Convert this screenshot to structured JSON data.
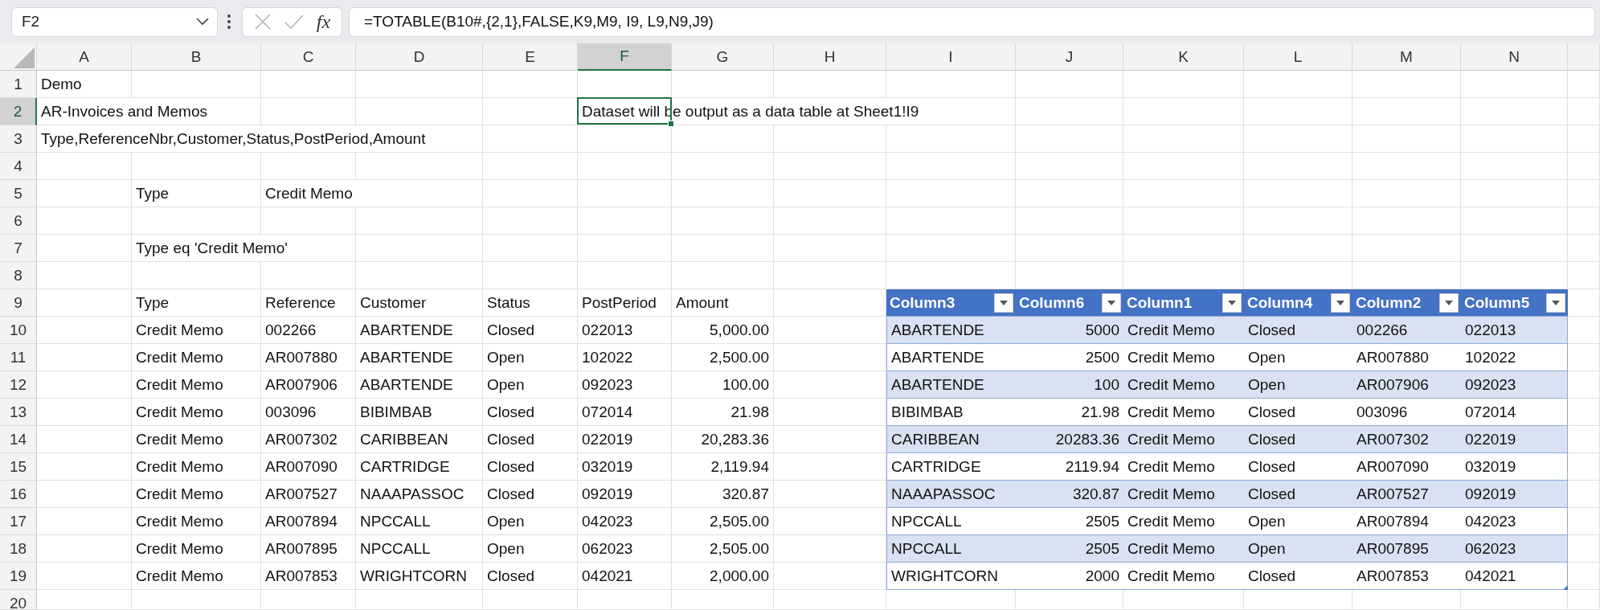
{
  "formula_bar": {
    "name_box": "F2",
    "fx_label": "fx",
    "formula": "=TOTABLE(B10#,{2,1},FALSE,K9,M9, I9, L9,N9,J9)"
  },
  "sheet": {
    "columns": [
      {
        "label": "A",
        "selected": false
      },
      {
        "label": "B",
        "selected": false
      },
      {
        "label": "C",
        "selected": false
      },
      {
        "label": "D",
        "selected": false
      },
      {
        "label": "E",
        "selected": false
      },
      {
        "label": "F",
        "selected": true
      },
      {
        "label": "G",
        "selected": false
      },
      {
        "label": "H",
        "selected": false
      },
      {
        "label": "I",
        "selected": false
      },
      {
        "label": "J",
        "selected": false
      },
      {
        "label": "K",
        "selected": false
      },
      {
        "label": "L",
        "selected": false
      },
      {
        "label": "M",
        "selected": false
      },
      {
        "label": "N",
        "selected": false
      }
    ],
    "rows": [
      {
        "number": "1",
        "selected": false,
        "cells": [
          "Demo"
        ]
      },
      {
        "number": "2",
        "selected": true,
        "cells": [
          "AR-Invoices and Memos",
          null,
          null,
          null,
          null,
          "Dataset will be output as a data table at Sheet1!I9"
        ]
      },
      {
        "number": "3",
        "selected": false,
        "cells": [
          "Type,ReferenceNbr,Customer,Status,PostPeriod,Amount"
        ]
      },
      {
        "number": "4",
        "selected": false,
        "cells": []
      },
      {
        "number": "5",
        "selected": false,
        "cells": [
          null,
          "Type",
          "Credit Memo"
        ]
      },
      {
        "number": "6",
        "selected": false,
        "cells": []
      },
      {
        "number": "7",
        "selected": false,
        "cells": [
          null,
          "Type eq 'Credit Memo'"
        ]
      },
      {
        "number": "8",
        "selected": false,
        "cells": []
      },
      {
        "number": "9",
        "selected": false,
        "cells": [
          null,
          "Type",
          "Reference",
          "Customer",
          "Status",
          "PostPeriod",
          "Amount"
        ]
      },
      {
        "number": "10",
        "selected": false,
        "cells": [
          null,
          "Credit Memo",
          "002266",
          "ABARTENDE",
          "Closed",
          "022013",
          {
            "text": "5,000.00",
            "kind": "number"
          }
        ]
      },
      {
        "number": "11",
        "selected": false,
        "cells": [
          null,
          "Credit Memo",
          "AR007880",
          "ABARTENDE",
          "Open",
          "102022",
          {
            "text": "2,500.00",
            "kind": "number"
          }
        ]
      },
      {
        "number": "12",
        "selected": false,
        "cells": [
          null,
          "Credit Memo",
          "AR007906",
          "ABARTENDE",
          "Open",
          "092023",
          {
            "text": "100.00",
            "kind": "number"
          }
        ]
      },
      {
        "number": "13",
        "selected": false,
        "cells": [
          null,
          "Credit Memo",
          "003096",
          "BIBIMBAB",
          "Closed",
          "072014",
          {
            "text": "21.98",
            "kind": "number"
          }
        ]
      },
      {
        "number": "14",
        "selected": false,
        "cells": [
          null,
          "Credit Memo",
          "AR007302",
          "CARIBBEAN",
          "Closed",
          "022019",
          {
            "text": "20,283.36",
            "kind": "number"
          }
        ]
      },
      {
        "number": "15",
        "selected": false,
        "cells": [
          null,
          "Credit Memo",
          "AR007090",
          "CARTRIDGE",
          "Closed",
          "032019",
          {
            "text": "2,119.94",
            "kind": "number"
          }
        ]
      },
      {
        "number": "16",
        "selected": false,
        "cells": [
          null,
          "Credit Memo",
          "AR007527",
          "NAAAPASSOC",
          "Closed",
          "092019",
          {
            "text": "320.87",
            "kind": "number"
          }
        ]
      },
      {
        "number": "17",
        "selected": false,
        "cells": [
          null,
          "Credit Memo",
          "AR007894",
          "NPCCALL",
          "Open",
          "042023",
          {
            "text": "2,505.00",
            "kind": "number"
          }
        ]
      },
      {
        "number": "18",
        "selected": false,
        "cells": [
          null,
          "Credit Memo",
          "AR007895",
          "NPCCALL",
          "Open",
          "062023",
          {
            "text": "2,505.00",
            "kind": "number"
          }
        ]
      },
      {
        "number": "19",
        "selected": false,
        "cells": [
          null,
          "Credit Memo",
          "AR007853",
          "WRIGHTCORN",
          "Closed",
          "042021",
          {
            "text": "2,000.00",
            "kind": "number"
          }
        ]
      },
      {
        "number": "20",
        "selected": false,
        "cells": []
      }
    ]
  },
  "data_table": {
    "columns": [
      {
        "label": "Column3",
        "kind": "text"
      },
      {
        "label": "Column6",
        "kind": "number"
      },
      {
        "label": "Column1",
        "kind": "text"
      },
      {
        "label": "Column4",
        "kind": "text"
      },
      {
        "label": "Column2",
        "kind": "text"
      },
      {
        "label": "Column5",
        "kind": "text"
      }
    ],
    "rows": [
      [
        "ABARTENDE",
        "5000",
        "Credit Memo",
        "Closed",
        "002266",
        "022013"
      ],
      [
        "ABARTENDE",
        "2500",
        "Credit Memo",
        "Open",
        "AR007880",
        "102022"
      ],
      [
        "ABARTENDE",
        "100",
        "Credit Memo",
        "Open",
        "AR007906",
        "092023"
      ],
      [
        "BIBIMBAB",
        "21.98",
        "Credit Memo",
        "Closed",
        "003096",
        "072014"
      ],
      [
        "CARIBBEAN",
        "20283.36",
        "Credit Memo",
        "Closed",
        "AR007302",
        "022019"
      ],
      [
        "CARTRIDGE",
        "2119.94",
        "Credit Memo",
        "Closed",
        "AR007090",
        "032019"
      ],
      [
        "NAAAPASSOC",
        "320.87",
        "Credit Memo",
        "Closed",
        "AR007527",
        "092019"
      ],
      [
        "NPCCALL",
        "2505",
        "Credit Memo",
        "Open",
        "AR007894",
        "042023"
      ],
      [
        "NPCCALL",
        "2505",
        "Credit Memo",
        "Open",
        "AR007895",
        "062023"
      ],
      [
        "WRIGHTCORN",
        "2000",
        "Credit Memo",
        "Closed",
        "AR007853",
        "042021"
      ]
    ]
  }
}
